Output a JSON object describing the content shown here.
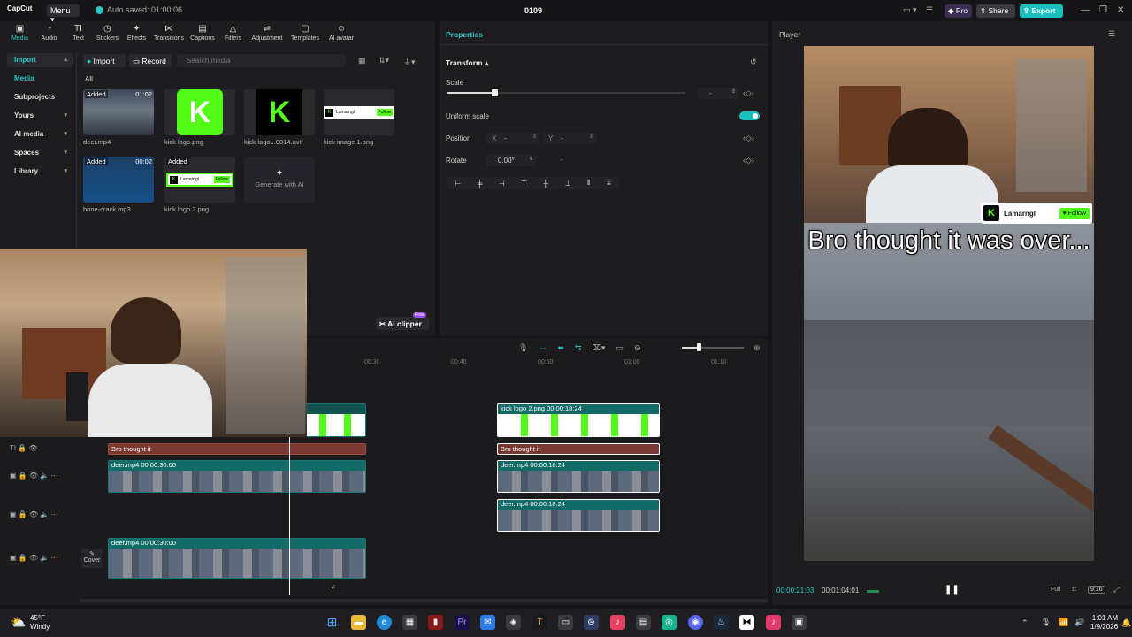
{
  "titlebar": {
    "logo": "CapCut",
    "menu_label": "Menu",
    "autosave": "Auto saved: 01:00:06",
    "project_name": "0109",
    "pro_label": "Pro",
    "share_label": "Share",
    "export_label": "Export"
  },
  "toolbar": {
    "tools": [
      "Media",
      "Audio",
      "Text",
      "Stickers",
      "Effects",
      "Transitions",
      "Captions",
      "Filters",
      "Adjustment",
      "Templates",
      "AI avatar"
    ],
    "active": "Media"
  },
  "sidenav": {
    "items": [
      "Import",
      "Media",
      "Subprojects",
      "Yours",
      "AI media",
      "Spaces",
      "Library"
    ]
  },
  "media": {
    "import_label": "Import",
    "record_label": "Record",
    "search_placeholder": "Search media",
    "all_tab": "All",
    "items": [
      {
        "name": "deer.mp4",
        "badge": "Added",
        "duration": "01:02"
      },
      {
        "name": "kick logo.png",
        "badge": "",
        "duration": ""
      },
      {
        "name": "kick-logo...0814.avif",
        "badge": "",
        "duration": ""
      },
      {
        "name": "kick image 1.png",
        "badge": "",
        "duration": ""
      },
      {
        "name": "bone-crack.mp3",
        "badge": "Added",
        "duration": "00:02"
      },
      {
        "name": "kick logo 2.png",
        "badge": "Added",
        "duration": ""
      },
      {
        "name": "Generate with AI",
        "badge": "",
        "duration": ""
      }
    ],
    "ai_clipper_label": "AI clipper",
    "free_badge": "Free"
  },
  "properties": {
    "title": "Properties",
    "section": "Transform",
    "scale_label": "Scale",
    "scale_value": "-",
    "uniform_scale_label": "Uniform scale",
    "uniform_scale_on": true,
    "position_label": "Position",
    "pos_x_label": "X",
    "pos_x_value": "-",
    "pos_y_label": "Y",
    "pos_y_value": "-",
    "rotate_label": "Rotate",
    "rotate_value": "0.00°",
    "rotate_extra": "-"
  },
  "player": {
    "title": "Player",
    "caption": "Bro thought it was over...",
    "channel": "Lamarngl",
    "follow_label": "Follow",
    "current_time": "00:00:21:03",
    "total_time": "00:01:04:01",
    "full_label": "Full",
    "ratio_label": "9:16"
  },
  "timeline": {
    "ruler": [
      "00:30",
      "00:40",
      "00:50",
      "01:00",
      "01:10"
    ],
    "cover_label": "Cover",
    "clips": {
      "kick_logo_2_a": "kick logo 2.png  00:00:18:24",
      "text_a": "Bro thought it",
      "text_b": "Bro thought it",
      "deer_a": "deer.mp4  00:00:30:00",
      "deer_b": "deer.mp4  00:00:18:24",
      "deer_c": "deer.mp4  00:00:18:24",
      "deer_main": "deer.mp4  00:00:30:00"
    }
  },
  "taskbar": {
    "temperature": "45°F",
    "weather": "Windy",
    "time": "1:01 AM",
    "date": "1/9/2026"
  }
}
